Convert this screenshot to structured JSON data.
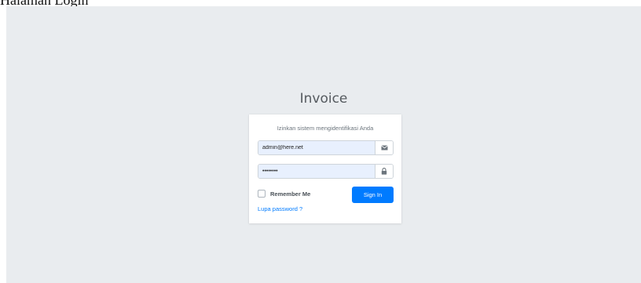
{
  "page_caption": "Halaman Login",
  "app": {
    "title": "Invoice"
  },
  "login": {
    "message": "Izinkan sistem mengidentifikasi Anda",
    "email": {
      "value": "admin@here.net",
      "icon": "envelope-icon"
    },
    "password": {
      "value": "12345678",
      "icon": "lock-icon"
    },
    "remember_label": "Remember Me",
    "remember_checked": false,
    "signin_label": "Sign In",
    "forgot_label": "Lupa password ?"
  },
  "colors": {
    "background": "#e9ecef",
    "primary": "#007bff",
    "input_autofill": "#e8f0fe"
  }
}
